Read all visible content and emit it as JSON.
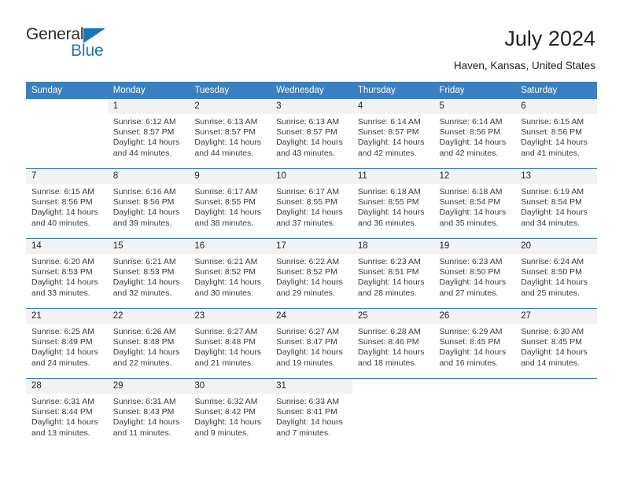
{
  "brand": {
    "name_part1": "General",
    "name_part2": "Blue",
    "triangle_color": "#1b75bb",
    "accent_color": "#3a7fbf"
  },
  "header": {
    "title": "July 2024",
    "subtitle": "Haven, Kansas, United States"
  },
  "calendar": {
    "weekday_headers": [
      "Sunday",
      "Monday",
      "Tuesday",
      "Wednesday",
      "Thursday",
      "Friday",
      "Saturday"
    ],
    "labels": {
      "sunrise": "Sunrise:",
      "sunset": "Sunset:",
      "daylight": "Daylight:"
    },
    "weeks": [
      [
        {
          "day": "",
          "sunrise": "",
          "sunset": "",
          "daylight_line1": "",
          "daylight_line2": "",
          "blank": true
        },
        {
          "day": "1",
          "sunrise": "Sunrise: 6:12 AM",
          "sunset": "Sunset: 8:57 PM",
          "daylight_line1": "Daylight: 14 hours",
          "daylight_line2": "and 44 minutes."
        },
        {
          "day": "2",
          "sunrise": "Sunrise: 6:13 AM",
          "sunset": "Sunset: 8:57 PM",
          "daylight_line1": "Daylight: 14 hours",
          "daylight_line2": "and 44 minutes."
        },
        {
          "day": "3",
          "sunrise": "Sunrise: 6:13 AM",
          "sunset": "Sunset: 8:57 PM",
          "daylight_line1": "Daylight: 14 hours",
          "daylight_line2": "and 43 minutes."
        },
        {
          "day": "4",
          "sunrise": "Sunrise: 6:14 AM",
          "sunset": "Sunset: 8:57 PM",
          "daylight_line1": "Daylight: 14 hours",
          "daylight_line2": "and 42 minutes."
        },
        {
          "day": "5",
          "sunrise": "Sunrise: 6:14 AM",
          "sunset": "Sunset: 8:56 PM",
          "daylight_line1": "Daylight: 14 hours",
          "daylight_line2": "and 42 minutes."
        },
        {
          "day": "6",
          "sunrise": "Sunrise: 6:15 AM",
          "sunset": "Sunset: 8:56 PM",
          "daylight_line1": "Daylight: 14 hours",
          "daylight_line2": "and 41 minutes."
        }
      ],
      [
        {
          "day": "7",
          "sunrise": "Sunrise: 6:15 AM",
          "sunset": "Sunset: 8:56 PM",
          "daylight_line1": "Daylight: 14 hours",
          "daylight_line2": "and 40 minutes."
        },
        {
          "day": "8",
          "sunrise": "Sunrise: 6:16 AM",
          "sunset": "Sunset: 8:56 PM",
          "daylight_line1": "Daylight: 14 hours",
          "daylight_line2": "and 39 minutes."
        },
        {
          "day": "9",
          "sunrise": "Sunrise: 6:17 AM",
          "sunset": "Sunset: 8:55 PM",
          "daylight_line1": "Daylight: 14 hours",
          "daylight_line2": "and 38 minutes."
        },
        {
          "day": "10",
          "sunrise": "Sunrise: 6:17 AM",
          "sunset": "Sunset: 8:55 PM",
          "daylight_line1": "Daylight: 14 hours",
          "daylight_line2": "and 37 minutes."
        },
        {
          "day": "11",
          "sunrise": "Sunrise: 6:18 AM",
          "sunset": "Sunset: 8:55 PM",
          "daylight_line1": "Daylight: 14 hours",
          "daylight_line2": "and 36 minutes."
        },
        {
          "day": "12",
          "sunrise": "Sunrise: 6:18 AM",
          "sunset": "Sunset: 8:54 PM",
          "daylight_line1": "Daylight: 14 hours",
          "daylight_line2": "and 35 minutes."
        },
        {
          "day": "13",
          "sunrise": "Sunrise: 6:19 AM",
          "sunset": "Sunset: 8:54 PM",
          "daylight_line1": "Daylight: 14 hours",
          "daylight_line2": "and 34 minutes."
        }
      ],
      [
        {
          "day": "14",
          "sunrise": "Sunrise: 6:20 AM",
          "sunset": "Sunset: 8:53 PM",
          "daylight_line1": "Daylight: 14 hours",
          "daylight_line2": "and 33 minutes."
        },
        {
          "day": "15",
          "sunrise": "Sunrise: 6:21 AM",
          "sunset": "Sunset: 8:53 PM",
          "daylight_line1": "Daylight: 14 hours",
          "daylight_line2": "and 32 minutes."
        },
        {
          "day": "16",
          "sunrise": "Sunrise: 6:21 AM",
          "sunset": "Sunset: 8:52 PM",
          "daylight_line1": "Daylight: 14 hours",
          "daylight_line2": "and 30 minutes."
        },
        {
          "day": "17",
          "sunrise": "Sunrise: 6:22 AM",
          "sunset": "Sunset: 8:52 PM",
          "daylight_line1": "Daylight: 14 hours",
          "daylight_line2": "and 29 minutes."
        },
        {
          "day": "18",
          "sunrise": "Sunrise: 6:23 AM",
          "sunset": "Sunset: 8:51 PM",
          "daylight_line1": "Daylight: 14 hours",
          "daylight_line2": "and 28 minutes."
        },
        {
          "day": "19",
          "sunrise": "Sunrise: 6:23 AM",
          "sunset": "Sunset: 8:50 PM",
          "daylight_line1": "Daylight: 14 hours",
          "daylight_line2": "and 27 minutes."
        },
        {
          "day": "20",
          "sunrise": "Sunrise: 6:24 AM",
          "sunset": "Sunset: 8:50 PM",
          "daylight_line1": "Daylight: 14 hours",
          "daylight_line2": "and 25 minutes."
        }
      ],
      [
        {
          "day": "21",
          "sunrise": "Sunrise: 6:25 AM",
          "sunset": "Sunset: 8:49 PM",
          "daylight_line1": "Daylight: 14 hours",
          "daylight_line2": "and 24 minutes."
        },
        {
          "day": "22",
          "sunrise": "Sunrise: 6:26 AM",
          "sunset": "Sunset: 8:48 PM",
          "daylight_line1": "Daylight: 14 hours",
          "daylight_line2": "and 22 minutes."
        },
        {
          "day": "23",
          "sunrise": "Sunrise: 6:27 AM",
          "sunset": "Sunset: 8:48 PM",
          "daylight_line1": "Daylight: 14 hours",
          "daylight_line2": "and 21 minutes."
        },
        {
          "day": "24",
          "sunrise": "Sunrise: 6:27 AM",
          "sunset": "Sunset: 8:47 PM",
          "daylight_line1": "Daylight: 14 hours",
          "daylight_line2": "and 19 minutes."
        },
        {
          "day": "25",
          "sunrise": "Sunrise: 6:28 AM",
          "sunset": "Sunset: 8:46 PM",
          "daylight_line1": "Daylight: 14 hours",
          "daylight_line2": "and 18 minutes."
        },
        {
          "day": "26",
          "sunrise": "Sunrise: 6:29 AM",
          "sunset": "Sunset: 8:45 PM",
          "daylight_line1": "Daylight: 14 hours",
          "daylight_line2": "and 16 minutes."
        },
        {
          "day": "27",
          "sunrise": "Sunrise: 6:30 AM",
          "sunset": "Sunset: 8:45 PM",
          "daylight_line1": "Daylight: 14 hours",
          "daylight_line2": "and 14 minutes."
        }
      ],
      [
        {
          "day": "28",
          "sunrise": "Sunrise: 6:31 AM",
          "sunset": "Sunset: 8:44 PM",
          "daylight_line1": "Daylight: 14 hours",
          "daylight_line2": "and 13 minutes."
        },
        {
          "day": "29",
          "sunrise": "Sunrise: 6:31 AM",
          "sunset": "Sunset: 8:43 PM",
          "daylight_line1": "Daylight: 14 hours",
          "daylight_line2": "and 11 minutes."
        },
        {
          "day": "30",
          "sunrise": "Sunrise: 6:32 AM",
          "sunset": "Sunset: 8:42 PM",
          "daylight_line1": "Daylight: 14 hours",
          "daylight_line2": "and 9 minutes."
        },
        {
          "day": "31",
          "sunrise": "Sunrise: 6:33 AM",
          "sunset": "Sunset: 8:41 PM",
          "daylight_line1": "Daylight: 14 hours",
          "daylight_line2": "and 7 minutes."
        },
        {
          "day": "",
          "sunrise": "",
          "sunset": "",
          "daylight_line1": "",
          "daylight_line2": "",
          "blank": true
        },
        {
          "day": "",
          "sunrise": "",
          "sunset": "",
          "daylight_line1": "",
          "daylight_line2": "",
          "blank": true
        },
        {
          "day": "",
          "sunrise": "",
          "sunset": "",
          "daylight_line1": "",
          "daylight_line2": "",
          "blank": true
        }
      ]
    ]
  }
}
